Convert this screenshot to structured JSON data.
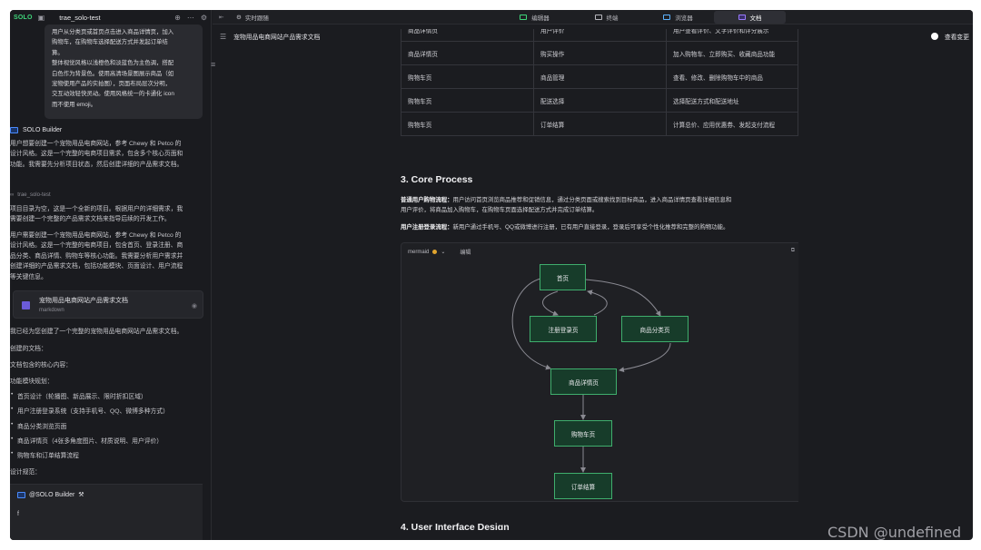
{
  "left": {
    "brand": "SOLO",
    "project": "trae_solo-test",
    "bubble_lines": [
      "用户从分类页或首页点击进入商品详情页，加入",
      "购物车，在购物车选择配送方式并发起订单结",
      "算。",
      "整体视觉风格以浅橙色和淡蓝色为主色调，搭配",
      "白色作为背景色。使用高清场景图展示商品（如",
      "宠物使用产品的实拍图），页面布局层次分明，",
      "交互动效轻快灵动。使用风格统一的卡通化 icon",
      "而不使用 emoji。"
    ],
    "agent_name": "SOLO Builder",
    "msg1": [
      "用户想要创建一个宠物用品电商网站，参考 Chewy 和 Petco 的",
      "设计风格。这是一个完整的电商项目需求，包含多个核心页面和",
      "功能。我需要先分析项目状态，然后创建详细的产品需求文档。"
    ],
    "proj_small": "trae_solo-test",
    "msg2": [
      "项目目录为空，这是一个全新的项目。根据用户的详细需求，我",
      "需要创建一个完整的产品需求文档来指导后续的开发工作。"
    ],
    "msg3": [
      "用户需要创建一个宠物用品电商网站，参考 Chewy 和 Petco 的",
      "设计风格。这是一个完整的电商项目，包含首页、登录注册、商",
      "品分类、商品详情、购物车等核心功能。我需要分析用户需求并",
      "创建详细的产品需求文档，包括功能模块、页面设计、用户流程",
      "等关键信息。"
    ],
    "card_title": "宠物用品电商网站产品需求文档",
    "card_sub": "markdown",
    "done": "我已经为您创建了一个完整的宠物用品电商网站产品需求文档。",
    "created": "创建的文档：",
    "content": "文档包含的核心内容：",
    "modules": "功能模块规划：",
    "bullets": [
      "首页设计（轮播图、新品展示、限时折扣区域）",
      "用户注册登录系统（支持手机号、QQ、微博多种方式）",
      "商品分类浏览页面",
      "商品详情页（4张多角度图片、材质说明、用户评价）",
      "购物车和订单结算流程"
    ],
    "design": "设计规范：",
    "input_tag": "@SOLO Builder",
    "input_val": "f"
  },
  "tabbar": {
    "live": "实时跟随",
    "tabs": [
      "编辑器",
      "终端",
      "浏览器",
      "文档"
    ],
    "active": 3
  },
  "doc": {
    "title": "宠物用品电商网站产品需求文档",
    "view_changes": "查看变更",
    "table": [
      [
        "商品详情页",
        "用户评价",
        "用户查看评价、文字评价和评分展示"
      ],
      [
        "商品详情页",
        "购买操作",
        "加入购物车、立即购买、收藏商品功能"
      ],
      [
        "购物车页",
        "商品管理",
        "查看、修改、删除购物车中的商品"
      ],
      [
        "购物车页",
        "配送选择",
        "选择配送方式和配送地址"
      ],
      [
        "购物车页",
        "订单结算",
        "计算总价、应用优惠券、发起支付流程"
      ]
    ],
    "h_core": "3. Core Process",
    "p1_label": "普通用户购物流程：",
    "p1_line1": "用户访问首页浏览商品推荐和促销信息，通过分类页面或搜索找到目标商品，进入商品详情页查看详细信息和",
    "p1_line2": "用户评价，将商品加入购物车，在购物车页面选择配送方式并完成订单结算。",
    "p2_label": "用户注册登录流程：",
    "p2_text": "新用户通过手机号、QQ或微博进行注册，已有用户直接登录，登录后可享受个性化推荐和完整的购物功能。",
    "mermaid_label": "mermaid",
    "mermaid_edit": "编辑",
    "nodes": {
      "home": "首页",
      "login": "注册登录页",
      "category": "商品分类页",
      "detail": "商品详情页",
      "cart": "购物车页",
      "checkout": "订单结算"
    },
    "h_ui": "4. User Interface Design"
  },
  "watermark": "CSDN @undefined"
}
